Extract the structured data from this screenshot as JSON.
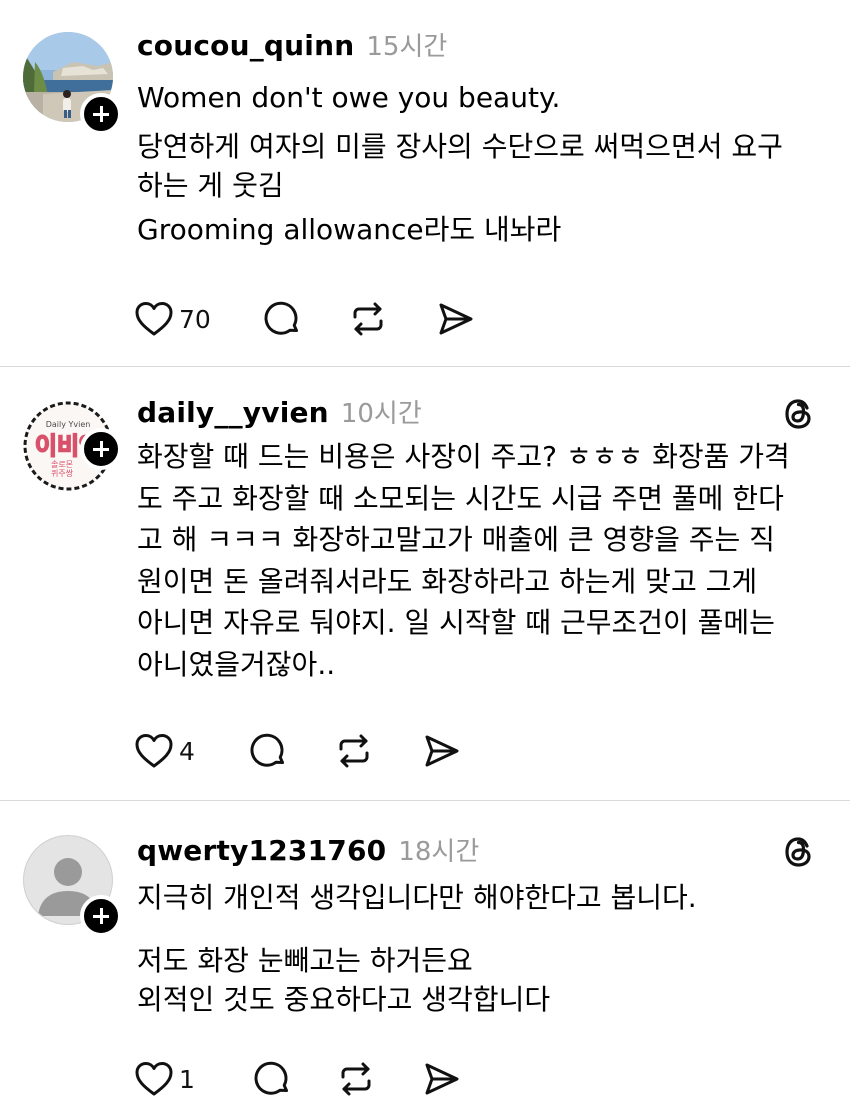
{
  "posts": [
    {
      "username": "coucou_quinn",
      "time": "15시간",
      "avatar": "photo-avatar",
      "has_threads_icon": false,
      "paragraphs": [
        [
          "Women don't owe you beauty."
        ],
        [
          "당연하게 여자의 미를 장사의 수단으로 써먹으면서 요구",
          "하는 게 웃김"
        ],
        [
          "Grooming allowance라도 내놔라"
        ]
      ],
      "likes": "70"
    },
    {
      "username": "daily__yvien",
      "time": "10시간",
      "avatar": "logo-avatar",
      "avatar_texts": [
        "Daily Yvien",
        "이비엔",
        "솔로몬 ",
        "퀴주쌍"
      ],
      "has_threads_icon": true,
      "paragraphs": [
        [
          "화장할 때 드는 비용은 사장이 주고? ㅎㅎㅎ 화장품 가격",
          "도 주고 화장할 때 소모되는 시간도 시급 주면 풀메 한다",
          "고 해 ㅋㅋㅋ 화장하고말고가 매출에 큰 영향을 주는 직",
          "원이면 돈 올려줘서라도 화장하라고 하는게 맞고 그게",
          "아니면 자유로 둬야지. 일 시작할 때 근무조건이 풀메는",
          "아니였을거잖아.."
        ]
      ],
      "likes": "4"
    },
    {
      "username": "qwerty1231760",
      "time": "18시간",
      "avatar": "default-avatar",
      "has_threads_icon": true,
      "paragraphs": [
        [
          "지극히 개인적 생각입니다만 해야한다고 봅니다."
        ],
        [
          "저도 화장 눈빼고는 하거든요",
          "외적인 것도 중요하다고 생각합니다"
        ]
      ],
      "likes": "1"
    }
  ],
  "icons": {
    "like": "heart-icon",
    "reply": "comment-bubble-icon",
    "repost": "repost-icon",
    "share": "send-icon",
    "follow": "plus-icon",
    "threads": "threads-logo-icon"
  }
}
